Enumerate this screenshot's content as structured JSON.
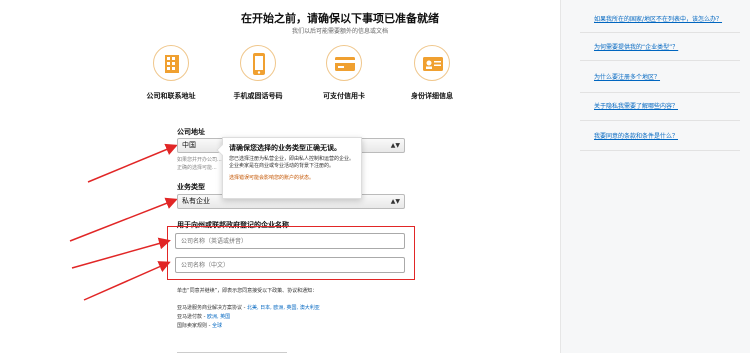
{
  "header": {
    "title": "在开始之前，请确保以下事项已准备就绪",
    "subtitle": "我们以后可能需要额外的信息或文档"
  },
  "requirements": [
    {
      "label": "公司和联系地址",
      "icon": "building-icon"
    },
    {
      "label": "手机或固话号码",
      "icon": "phone-icon"
    },
    {
      "label": "可支付信用卡",
      "icon": "credit-card-icon"
    },
    {
      "label": "身份详细信息",
      "icon": "id-card-icon"
    }
  ],
  "form": {
    "company_address_label": "公司地址",
    "country_value": "中国",
    "country_hint": "如果您并开办公司... 不正确的选择可能...",
    "business_type_label": "业务类型",
    "business_type_value": "私有企业",
    "company_name_label": "用于向州或联邦政府登记的企业名称",
    "company_name_pinyin_placeholder": "公司名称（英语或拼音）",
    "company_name_chinese_placeholder": "公司名称（中文）"
  },
  "tooltip": {
    "title": "请确保您选择的业务类型正确无误。",
    "body": "您已选择注册为私营企业，即由私人控制和运营的企业。企业卖家是在商业或专业活动的背景下注册的。",
    "warning": "选择错误可能会影响您的账户的状态。"
  },
  "consent": {
    "text": "单击“同意并继续”，即表示您同意接受以下政策、协议和通知：",
    "policies": [
      {
        "name": "亚马逊服务商业解决方案协议 -",
        "links": "北美, 日本, 欧洲, 英国, 澳大利亚"
      },
      {
        "name": "亚马逊付款 -",
        "links": "欧洲, 英国"
      },
      {
        "name": "国际卖家规则 -",
        "links": "全球"
      }
    ]
  },
  "sidebar": {
    "links": [
      "如果我所在的国家/地区不在列表中，该怎么办？",
      "为何需要提供我的“企业类型”？",
      "为什么要注册多个地区？",
      "关于隐私我需要了解哪些内容？",
      "我要同意的条款和条件是什么？"
    ]
  },
  "colors": {
    "accent_orange": "#f0a030",
    "link_blue": "#0066c0",
    "annotation_red": "#e12626"
  }
}
